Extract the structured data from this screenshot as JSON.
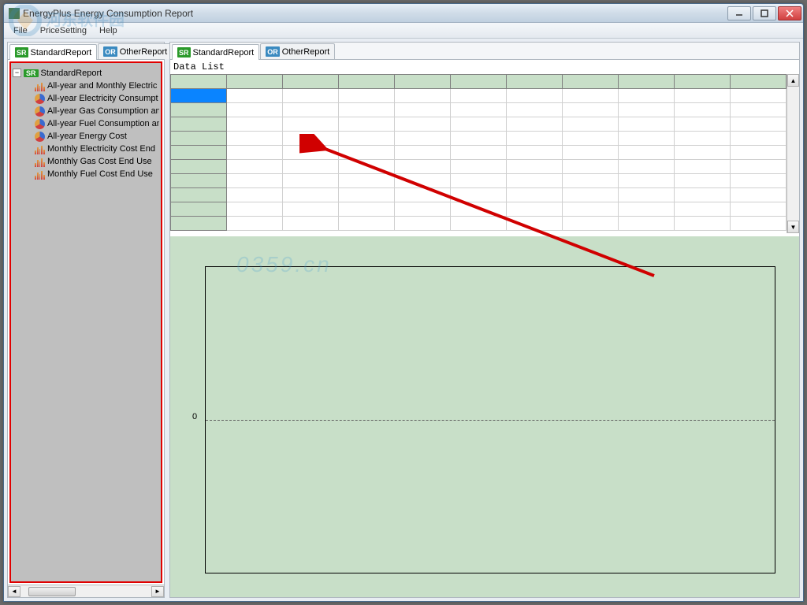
{
  "window": {
    "title": "EnergyPlus Energy Consumption Report"
  },
  "menubar": {
    "file": "File",
    "price": "PriceSetting",
    "help": "Help"
  },
  "left_tabs": {
    "sr_badge": "SR",
    "sr_label": "StandardReport",
    "or_badge": "OR",
    "or_label": "OtherReport"
  },
  "right_tabs": {
    "sr_badge": "SR",
    "sr_label": "StandardReport",
    "or_badge": "OR",
    "or_label": "OtherReport"
  },
  "tree": {
    "root_badge": "SR",
    "root_label": "StandardReport",
    "items": [
      {
        "icon": "bar",
        "label": "All-year and Monthly Electric"
      },
      {
        "icon": "pie",
        "label": "All-year Electricity Consumpt"
      },
      {
        "icon": "pie",
        "label": "All-year Gas Consumption an"
      },
      {
        "icon": "pie",
        "label": "All-year Fuel Consumption an"
      },
      {
        "icon": "pie",
        "label": "All-year Energy Cost"
      },
      {
        "icon": "bar",
        "label": "Monthly Electricity Cost End"
      },
      {
        "icon": "bar",
        "label": "Monthly Gas Cost End Use"
      },
      {
        "icon": "bar",
        "label": "Monthly Fuel Cost End Use"
      }
    ]
  },
  "data": {
    "header": "Data List"
  },
  "chart_data": {
    "type": "line",
    "title": "",
    "xlabel": "",
    "ylabel": "",
    "ylim": [
      -1,
      1
    ],
    "y_ticks": [
      0
    ],
    "series": [],
    "categories": []
  }
}
